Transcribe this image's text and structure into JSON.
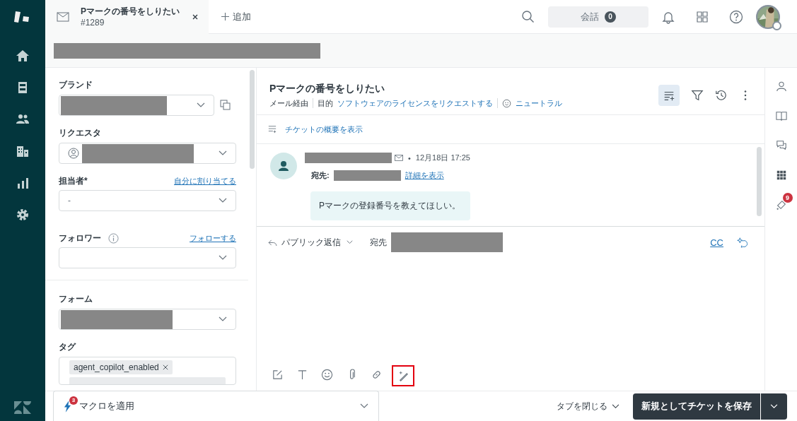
{
  "tab": {
    "title": "Pマークの番号をしりたい",
    "number": "#1289"
  },
  "add_tab": "追加",
  "conversations": {
    "label": "会話",
    "count": "0"
  },
  "fields": {
    "brand": "ブランド",
    "requester": "リクエスタ",
    "assignee": "担当者*",
    "assign_link": "自分に割り当てる",
    "assignee_value": "-",
    "followers": "フォロワー",
    "follow_link": "フォローする",
    "form": "フォーム",
    "tags_label": "タグ",
    "tags": [
      "agent_copilot_enabled"
    ]
  },
  "ticket": {
    "title": "Pマークの番号をしりたい",
    "via": "メール経由",
    "purpose_label": "目的",
    "purpose": "ソフトウェアのライセンスをリクエストする",
    "sentiment": "ニュートラル",
    "summary_link": "チケットの概要を表示"
  },
  "message": {
    "separator": "•",
    "time": "12月18日 17:25",
    "to_label": "宛先:",
    "details_link": "詳細を表示",
    "body": "Pマークの登録番号を教えてほしい。"
  },
  "composer": {
    "mode": "パブリック返信",
    "to_label": "宛先",
    "cc": "CC",
    "tools": [
      {
        "kind": "compose",
        "highlighted": false
      },
      {
        "kind": "text",
        "highlighted": false
      },
      {
        "kind": "emoji",
        "highlighted": false
      },
      {
        "kind": "attach",
        "highlighted": false
      },
      {
        "kind": "link",
        "highlighted": false
      },
      {
        "kind": "wand",
        "highlighted": true
      }
    ]
  },
  "rail_badge": "9",
  "macro": {
    "label": "マクロを適用",
    "badge": "3"
  },
  "close_tab": "タブを閉じる",
  "save": "新規としてチケットを保存"
}
